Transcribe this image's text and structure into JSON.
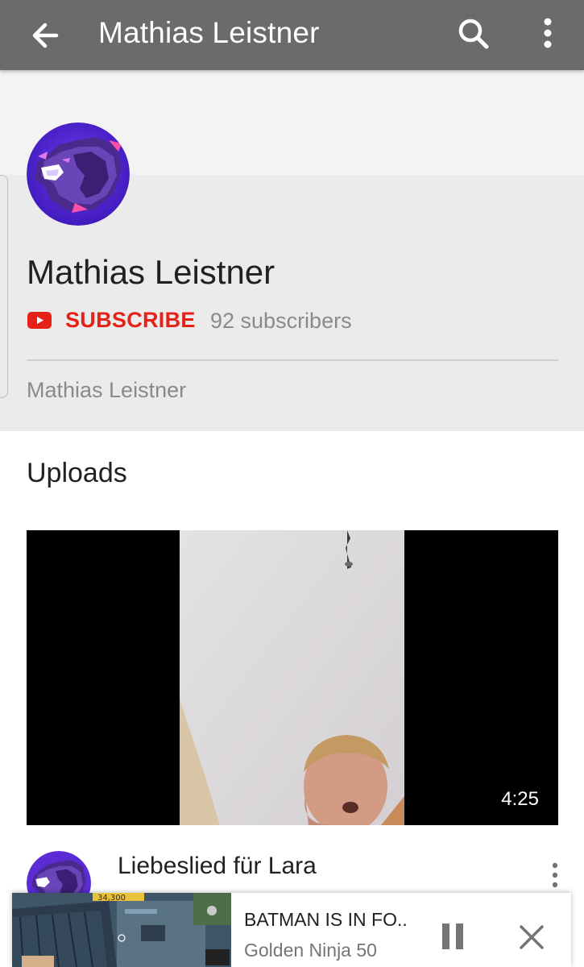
{
  "appbar": {
    "title": "Mathias Leistner",
    "icons": [
      "arrow-back-icon",
      "search-icon",
      "more-vert-icon"
    ]
  },
  "channel": {
    "name": "Mathias Leistner",
    "subscribe_label": "SUBSCRIBE",
    "subscriber_count": "92 subscribers",
    "description": "Mathias Leistner",
    "avatar_icon": "wolf-logo-icon"
  },
  "uploads": {
    "section_title": "Uploads",
    "videos": [
      {
        "title": "Liebeslied für Lara",
        "duration": "4:25"
      }
    ]
  },
  "miniplayer": {
    "title": "BATMAN IS IN FO..",
    "channel": "Golden Ninja 50",
    "hud_text": "34,300"
  },
  "colors": {
    "appbar_bg": "#6b6b6b",
    "accent_red": "#e62117",
    "header_bg": "#ebebeb",
    "avatar_purple": "#5b2bd6"
  }
}
